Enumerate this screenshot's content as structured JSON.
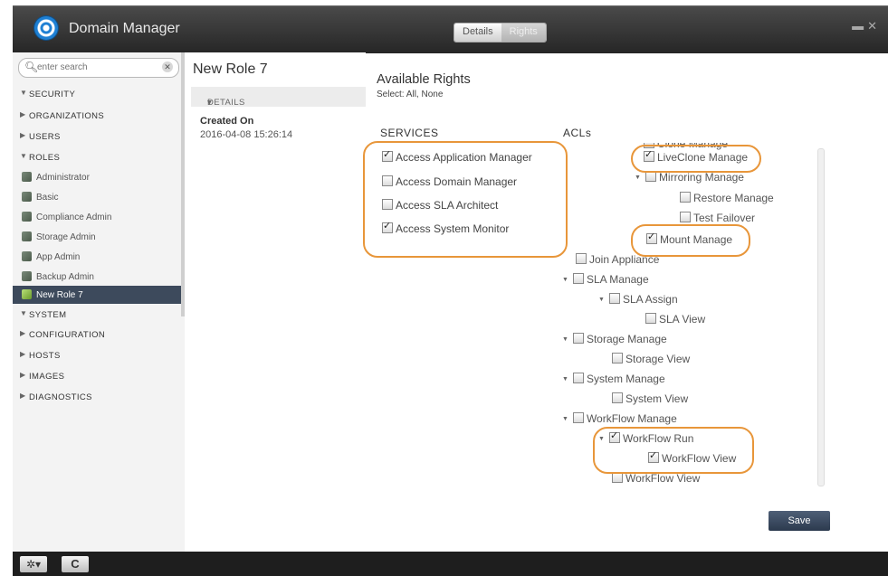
{
  "app": {
    "title": "Domain Manager"
  },
  "tabs": [
    {
      "label": "Details"
    },
    {
      "label": "Rights"
    }
  ],
  "search": {
    "placeholder": "enter search"
  },
  "sidebar": {
    "sections": [
      {
        "label": "SECURITY"
      },
      {
        "label": "ORGANIZATIONS"
      },
      {
        "label": "USERS"
      },
      {
        "label": "ROLES"
      },
      {
        "label": "SYSTEM"
      },
      {
        "label": "CONFIGURATION"
      },
      {
        "label": "HOSTS"
      },
      {
        "label": "IMAGES"
      },
      {
        "label": "DIAGNOSTICS"
      }
    ],
    "roles": [
      {
        "label": "Administrator"
      },
      {
        "label": "Basic"
      },
      {
        "label": "Compliance Admin"
      },
      {
        "label": "Storage Admin"
      },
      {
        "label": "App Admin"
      },
      {
        "label": "Backup Admin"
      },
      {
        "label": "New Role 7"
      }
    ]
  },
  "details": {
    "title": "New Role 7",
    "section_label": "DETAILS",
    "created_label": "Created On",
    "created_value": "2016-04-08 15:26:14"
  },
  "rights": {
    "title": "Available Rights",
    "select_text": "Select: All, None",
    "services_header": "SERVICES",
    "acls_header": "ACLs",
    "services": [
      {
        "label": "Access Application Manager",
        "checked": true
      },
      {
        "label": "Access Domain Manager",
        "checked": false
      },
      {
        "label": "Access SLA Architect",
        "checked": false
      },
      {
        "label": "Access System Monitor",
        "checked": true
      }
    ],
    "acls": [
      {
        "label": "Clone Manage",
        "checked": false
      },
      {
        "label": "LiveClone Manage",
        "checked": true
      },
      {
        "label": "Mirroring Manage",
        "checked": false
      },
      {
        "label": "Restore Manage",
        "checked": false
      },
      {
        "label": "Test Failover",
        "checked": false
      },
      {
        "label": "Mount Manage",
        "checked": true
      },
      {
        "label": "Join Appliance",
        "checked": false
      },
      {
        "label": "SLA Manage",
        "checked": false
      },
      {
        "label": "SLA Assign",
        "checked": false
      },
      {
        "label": "SLA View",
        "checked": false
      },
      {
        "label": "Storage Manage",
        "checked": false
      },
      {
        "label": "Storage View",
        "checked": false
      },
      {
        "label": "System Manage",
        "checked": false
      },
      {
        "label": "System View",
        "checked": false
      },
      {
        "label": "WorkFlow Manage",
        "checked": false
      },
      {
        "label": "WorkFlow Run",
        "checked": true
      },
      {
        "label": "WorkFlow View",
        "checked": true
      },
      {
        "label": "WorkFlow View",
        "checked": false
      }
    ]
  },
  "buttons": {
    "save": "Save",
    "refresh": "C",
    "settings": "✲▾"
  },
  "colors": {
    "highlight": "#e8963a",
    "selected_row": "#3d4a5c",
    "save_button": "#34435a"
  }
}
